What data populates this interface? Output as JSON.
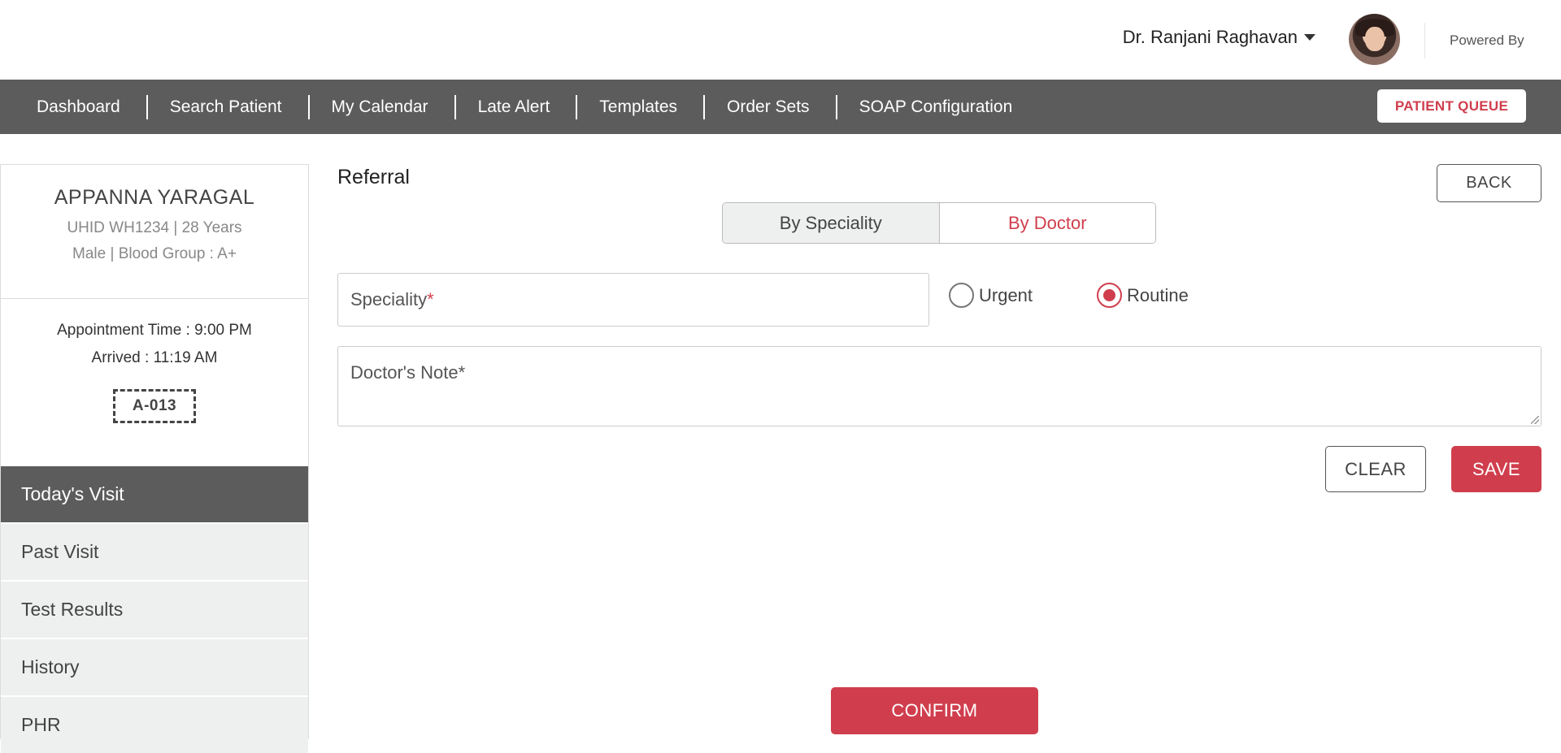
{
  "header": {
    "user_name": "Dr. Ranjani Raghavan",
    "powered_by": "Powered By"
  },
  "nav": {
    "items": [
      {
        "label": "Dashboard"
      },
      {
        "label": "Search Patient"
      },
      {
        "label": "My Calendar"
      },
      {
        "label": "Late Alert"
      },
      {
        "label": "Templates"
      },
      {
        "label": "Order Sets"
      },
      {
        "label": "SOAP Configuration"
      }
    ],
    "queue_label": "PATIENT QUEUE"
  },
  "patient": {
    "name": "APPANNA YARAGAL",
    "line1": "UHID WH1234 | 28 Years",
    "line2": "Male | Blood Group : A+",
    "appointment": "Appointment Time : 9:00 PM",
    "arrived": "Arrived : 11:19 AM",
    "token": "A-013"
  },
  "sidebar": {
    "items": [
      {
        "label": "Today's Visit",
        "active": true
      },
      {
        "label": "Past Visit"
      },
      {
        "label": "Test Results"
      },
      {
        "label": "History"
      },
      {
        "label": "PHR"
      }
    ]
  },
  "referral": {
    "title": "Referral",
    "back_label": "BACK",
    "toggle": {
      "by_speciality": "By Speciality",
      "by_doctor": "By Doctor"
    },
    "speciality_placeholder": "Speciality",
    "required_mark": "*",
    "urgency": {
      "urgent": "Urgent",
      "routine": "Routine",
      "selected": "Routine"
    },
    "note_placeholder": "Doctor's Note*",
    "clear_label": "CLEAR",
    "save_label": "SAVE",
    "confirm_label": "CONFIRM"
  },
  "colors": {
    "accent": "#d03e4d",
    "nav_bg": "#5c5c5c",
    "menu_bg": "#eef0ef"
  }
}
